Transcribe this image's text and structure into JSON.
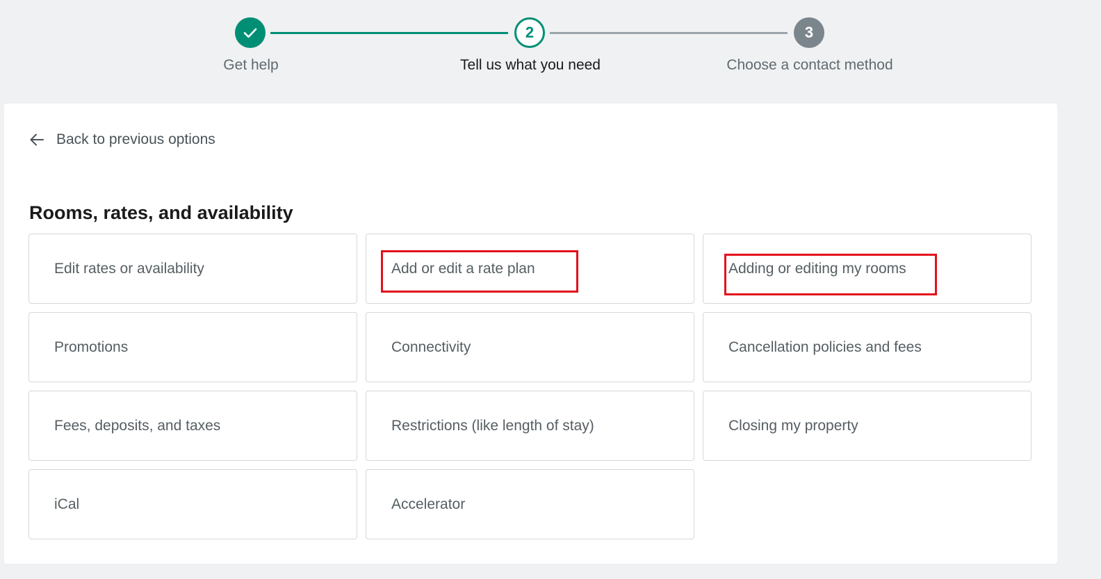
{
  "stepper": {
    "steps": [
      {
        "label": "Get help",
        "status": "done"
      },
      {
        "label": "Tell us what you need",
        "number": "2",
        "status": "active"
      },
      {
        "label": "Choose a contact method",
        "number": "3",
        "status": "upcoming"
      }
    ],
    "accent_color": "#008f75",
    "inactive_color": "#7b868c"
  },
  "back_link": {
    "label": "Back to previous options",
    "icon": "arrow-left-icon"
  },
  "section": {
    "title": "Rooms, rates, and availability",
    "options": [
      {
        "label": "Edit rates or availability"
      },
      {
        "label": "Add or edit a rate plan"
      },
      {
        "label": "Adding or editing my rooms"
      },
      {
        "label": "Promotions"
      },
      {
        "label": "Connectivity"
      },
      {
        "label": "Cancellation policies and fees"
      },
      {
        "label": "Fees, deposits, and taxes"
      },
      {
        "label": "Restrictions (like length of stay)"
      },
      {
        "label": "Closing my property"
      },
      {
        "label": "iCal"
      },
      {
        "label": "Accelerator"
      }
    ]
  },
  "annotation_color": "#e3101b"
}
